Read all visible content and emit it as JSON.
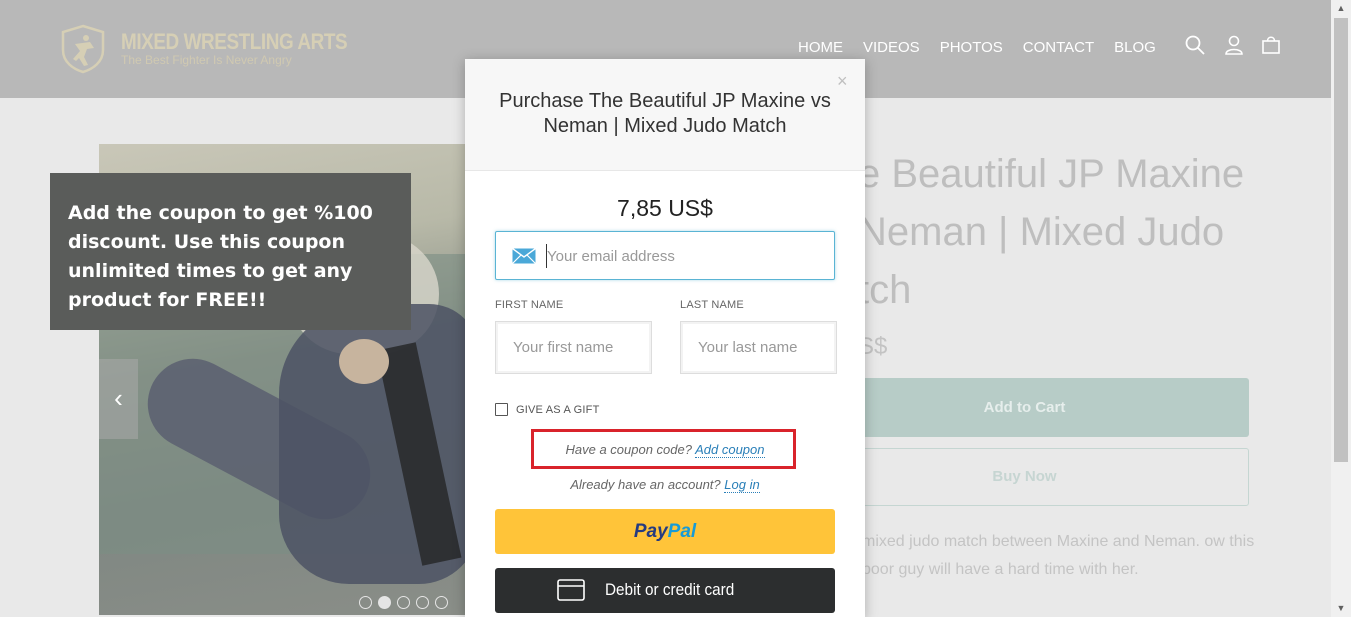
{
  "header": {
    "logo_title": "MIXED WRESTLING ARTS",
    "logo_subtitle": "The Best Fighter Is Never Angry",
    "nav": [
      "HOME",
      "VIDEOS",
      "PHOTOS",
      "CONTACT",
      "BLOG"
    ]
  },
  "promo": {
    "text": "Add the coupon to get %100 discount. Use this coupon unlimited times to get any product for FREE!!"
  },
  "product": {
    "title_partial": "e Beautiful JP Maxine Neman | Mixed Judo tch",
    "price_partial": "S$",
    "add_to_cart": "Add to Cart",
    "buy_now": "Buy Now",
    "description_partial": "mixed judo match between Maxine and Neman. ow this poor guy will have a hard time with her."
  },
  "modal": {
    "close": "×",
    "title": "Purchase The Beautiful JP Maxine vs Neman | Mixed Judo Match",
    "price": "7,85 US$",
    "email_placeholder": "Your email address",
    "first_name_label": "FIRST NAME",
    "first_name_placeholder": "Your first name",
    "last_name_label": "LAST NAME",
    "last_name_placeholder": "Your last name",
    "gift_label": "GIVE AS A GIFT",
    "coupon_prompt": "Have a coupon code?",
    "coupon_link": "Add coupon",
    "account_prompt": "Already have an account?",
    "login_link": "Log in",
    "paypal_pay": "Pay",
    "paypal_pal": "Pal",
    "card_label": "Debit or credit card"
  },
  "colors": {
    "highlight_border": "#d9232b",
    "link": "#2a7fb8",
    "paypal_yellow": "#ffc439",
    "card_button": "#2c2e2f",
    "email_focus": "#5ab4d4"
  },
  "icons": [
    "logo-shield-icon",
    "search-icon",
    "user-icon",
    "bag-icon",
    "chevron-left-icon",
    "envelope-icon",
    "credit-card-icon",
    "close-icon"
  ]
}
